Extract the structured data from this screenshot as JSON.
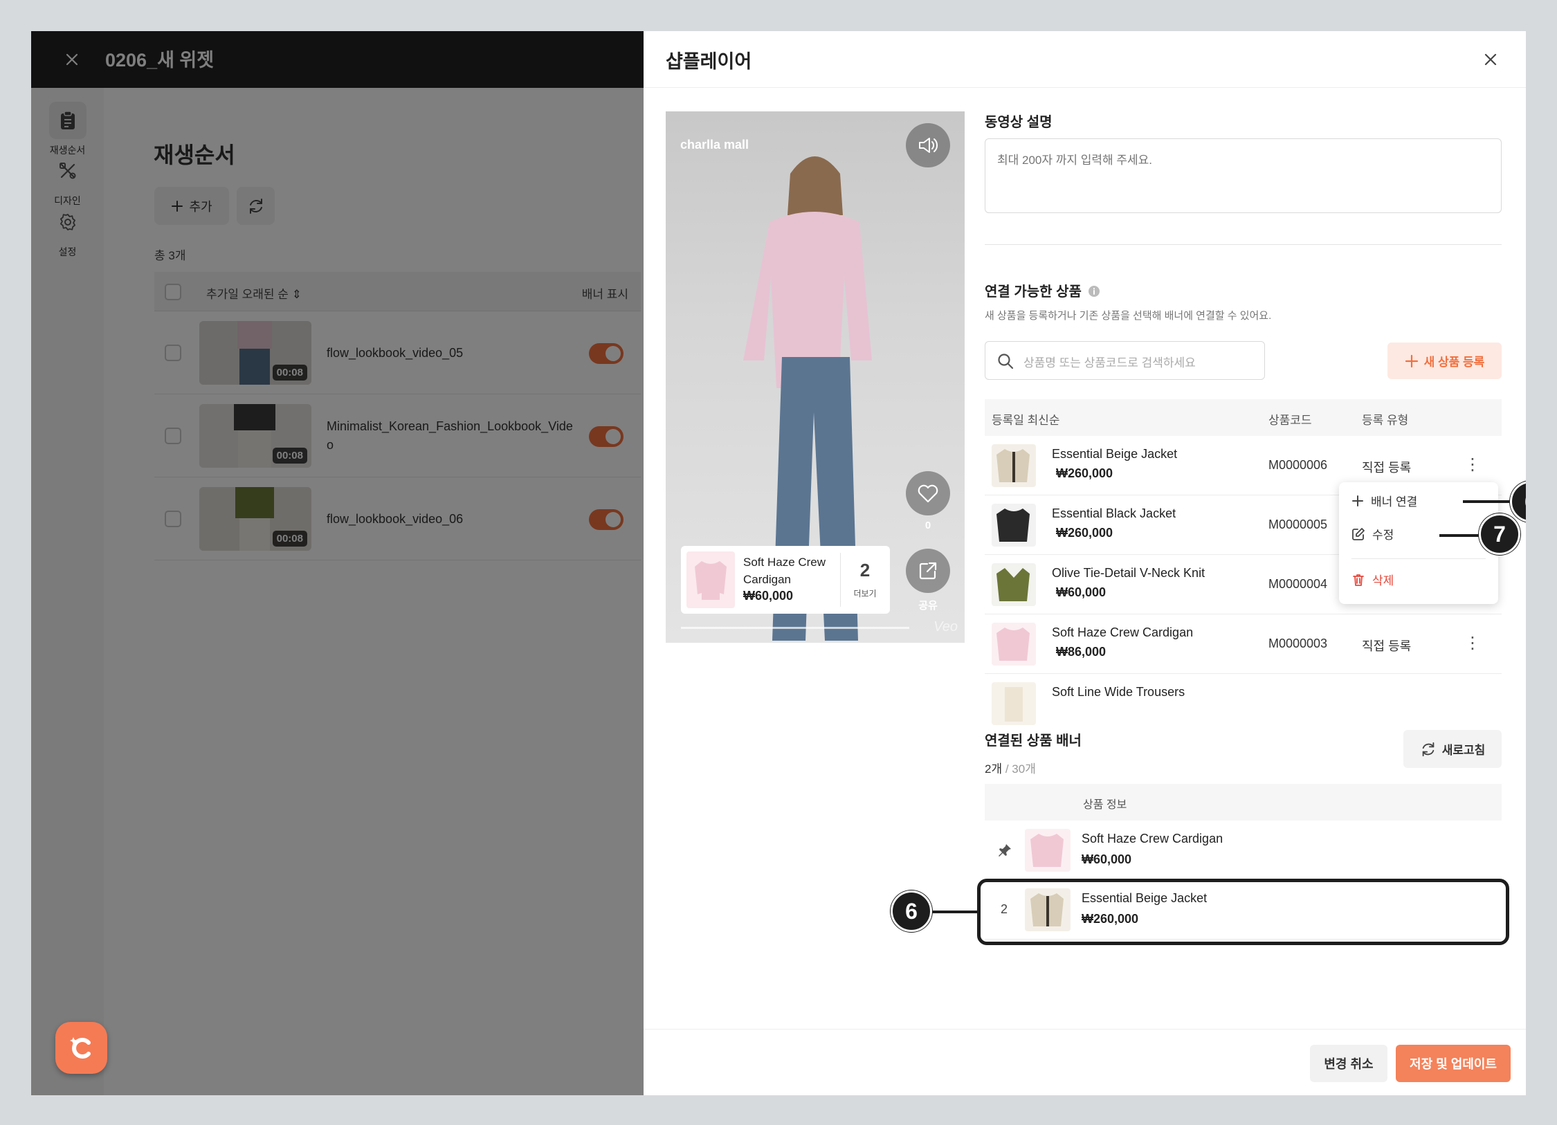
{
  "app": {
    "title": "0206_새 위젯"
  },
  "sidenav": [
    {
      "label": "재생순서",
      "icon": "clipboard-icon"
    },
    {
      "label": "디자인",
      "icon": "design-tools-icon"
    },
    {
      "label": "설정",
      "icon": "gear-icon"
    }
  ],
  "playlist": {
    "heading": "재생순서",
    "add_label": "추가",
    "total": "총 3개",
    "sort_label": "추가일 오래된 순",
    "banner_col": "배너 표시",
    "rows": [
      {
        "name": "flow_lookbook_video_05",
        "duration": "00:08"
      },
      {
        "name": "Minimalist_Korean_Fashion_Lookbook_Video",
        "duration": "00:08"
      },
      {
        "name": "flow_lookbook_video_06",
        "duration": "00:08"
      }
    ]
  },
  "panel": {
    "title": "샵플레이어",
    "video": {
      "brand": "charlla mall",
      "likes": "0",
      "share": "공유",
      "watermark": "Veo",
      "card": {
        "name": "Soft Haze Crew Cardigan",
        "price": "₩60,000",
        "more_count": "2",
        "more_label": "더보기"
      }
    },
    "description": {
      "label": "동영상 설명",
      "placeholder": "최대 200자 까지 입력해 주세요."
    },
    "products": {
      "label": "연결 가능한 상품",
      "sub": "새 상품을 등록하거나 기존 상품을 선택해 배너에 연결할 수 있어요.",
      "search_placeholder": "상품명 또는 상품코드로 검색하세요",
      "new_button": "새 상품 등록",
      "col_sort": "등록일 최신순",
      "col_code": "상품코드",
      "col_type": "등록 유형",
      "rows": [
        {
          "name": "Essential Beige Jacket",
          "price": "₩260,000",
          "code": "M0000006",
          "type": "직접 등록"
        },
        {
          "name": "Essential Black Jacket",
          "price": "₩260,000",
          "code": "M0000005",
          "type": ""
        },
        {
          "name": "Olive Tie-Detail V-Neck Knit",
          "price": "₩60,000",
          "code": "M0000004",
          "type": ""
        },
        {
          "name": "Soft Haze Crew Cardigan",
          "price": "₩86,000",
          "code": "M0000003",
          "type": "직접 등록"
        },
        {
          "name": "Soft Line Wide Trousers",
          "price": "",
          "code": "",
          "type": ""
        }
      ],
      "menu": {
        "link": "배너 연결",
        "edit": "수정",
        "delete": "삭제"
      }
    },
    "banners": {
      "label": "연결된 상품 배너",
      "count": "2개",
      "max": " / 30개",
      "refresh": "새로고침",
      "col_info": "상품 정보",
      "rows": [
        {
          "index": "",
          "name": "Soft Haze Crew Cardigan",
          "price": "₩60,000"
        },
        {
          "index": "2",
          "name": "Essential Beige Jacket",
          "price": "₩260,000"
        }
      ]
    },
    "footer": {
      "cancel": "변경 취소",
      "save": "저장 및 업데이트"
    }
  },
  "callouts": [
    "6",
    "7",
    "6"
  ],
  "colors": {
    "accent": "#f0703f",
    "dark": "#222222",
    "danger": "#e5483b"
  }
}
